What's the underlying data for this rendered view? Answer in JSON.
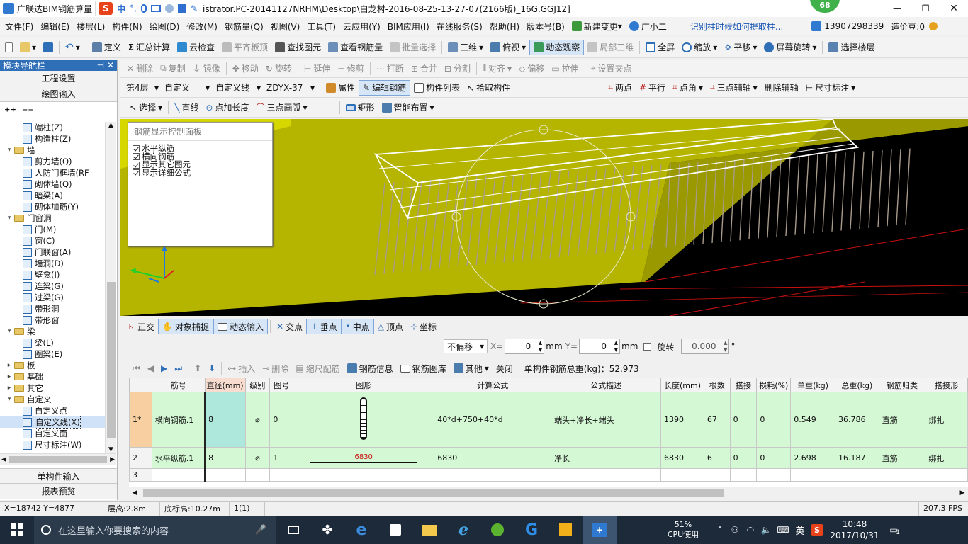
{
  "title_bar": {
    "app": "广联达BIM钢筋算量",
    "path": "istrator.PC-20141127NRHM\\Desktop\\白龙村-2016-08-25-13-27-07(2166版)_16G.GGJ12]",
    "badge": "68"
  },
  "menu": [
    "文件(F)",
    "编辑(E)",
    "楼层(L)",
    "构件(N)",
    "绘图(D)",
    "修改(M)",
    "钢筋量(Q)",
    "视图(V)",
    "工具(T)",
    "云应用(Y)",
    "BIM应用(I)",
    "在线服务(S)",
    "帮助(H)",
    "版本号(B)",
    "新建变更",
    "广小二"
  ],
  "menu_right": {
    "hint": "识别柱时候如何提取柱...",
    "phone": "13907298339",
    "points": "造价豆:0"
  },
  "toolbar1": [
    "定义",
    "汇总计算",
    "云检查",
    "平齐板顶",
    "查找图元",
    "查看钢筋量",
    "批量选择",
    "三维",
    "俯视",
    "动态观察",
    "局部三维",
    "全屏",
    "缩放",
    "平移",
    "屏幕旋转",
    "选择楼层"
  ],
  "toolbar2": [
    "删除",
    "复制",
    "镜像",
    "移动",
    "旋转",
    "延伸",
    "修剪",
    "打断",
    "合并",
    "分割",
    "对齐",
    "偏移",
    "拉伸",
    "设置夹点"
  ],
  "toolbar3": {
    "floor": "第4层",
    "type": "自定义",
    "subtype": "自定义线",
    "name": "ZDYX-37",
    "buttons": [
      "属性",
      "编辑钢筋",
      "构件列表",
      "拾取构件"
    ],
    "right": [
      "两点",
      "平行",
      "点角",
      "三点辅轴",
      "删除辅轴",
      "尺寸标注"
    ]
  },
  "toolbar4": [
    "选择",
    "直线",
    "点加长度",
    "三点画弧",
    "矩形",
    "智能布置"
  ],
  "sidebar": {
    "header": "模块导航栏",
    "btn_project": "工程设置",
    "btn_draw": "绘图输入",
    "tree": [
      {
        "indent": 2,
        "label": "端柱(Z)"
      },
      {
        "indent": 2,
        "label": "构造柱(Z)"
      },
      {
        "indent": 0,
        "label": "墙",
        "folder": true,
        "open": true
      },
      {
        "indent": 2,
        "label": "剪力墙(Q)"
      },
      {
        "indent": 2,
        "label": "人防门框墙(RF"
      },
      {
        "indent": 2,
        "label": "砌体墙(Q)"
      },
      {
        "indent": 2,
        "label": "暗梁(A)"
      },
      {
        "indent": 2,
        "label": "砌体加筋(Y)"
      },
      {
        "indent": 0,
        "label": "门窗洞",
        "folder": true,
        "open": true
      },
      {
        "indent": 2,
        "label": "门(M)"
      },
      {
        "indent": 2,
        "label": "窗(C)"
      },
      {
        "indent": 2,
        "label": "门联窗(A)"
      },
      {
        "indent": 2,
        "label": "墙洞(D)"
      },
      {
        "indent": 2,
        "label": "壁龛(I)"
      },
      {
        "indent": 2,
        "label": "连梁(G)"
      },
      {
        "indent": 2,
        "label": "过梁(G)"
      },
      {
        "indent": 2,
        "label": "带形洞"
      },
      {
        "indent": 2,
        "label": "带形窗"
      },
      {
        "indent": 0,
        "label": "梁",
        "folder": true,
        "open": true
      },
      {
        "indent": 2,
        "label": "梁(L)"
      },
      {
        "indent": 2,
        "label": "圈梁(E)"
      },
      {
        "indent": 0,
        "label": "板",
        "folder": true,
        "open": false
      },
      {
        "indent": 0,
        "label": "基础",
        "folder": true,
        "open": false
      },
      {
        "indent": 0,
        "label": "其它",
        "folder": true,
        "open": false
      },
      {
        "indent": 0,
        "label": "自定义",
        "folder": true,
        "open": true
      },
      {
        "indent": 2,
        "label": "自定义点"
      },
      {
        "indent": 2,
        "label": "自定义线(X)",
        "selected": true
      },
      {
        "indent": 2,
        "label": "自定义面"
      },
      {
        "indent": 2,
        "label": "尺寸标注(W)"
      }
    ],
    "btn_single": "单构件输入",
    "btn_report": "报表预览"
  },
  "panel": {
    "title": "钢筋显示控制面板",
    "items": [
      "水平纵筋",
      "横向钢筋",
      "显示其它图元",
      "显示详细公式"
    ]
  },
  "snapbar": [
    "正交",
    "对象捕捉",
    "动态输入",
    "交点",
    "垂点",
    "中点",
    "顶点",
    "坐标"
  ],
  "offsetbar": {
    "mode": "不偏移",
    "x_label": "X=",
    "x": "0",
    "y_label": "Y=",
    "y": "0",
    "unit": "mm",
    "rotate_label": "旋转",
    "rotate": "0.000",
    "deg": "°"
  },
  "gridbar": {
    "buttons": [
      "插入",
      "删除",
      "缩尺配筋",
      "钢筋信息",
      "钢筋图库",
      "其他",
      "关闭"
    ],
    "total": "单构件钢筋总重(kg)：52.973"
  },
  "table": {
    "headers": [
      "筋号",
      "直径(mm)",
      "级别",
      "图号",
      "图形",
      "计算公式",
      "公式描述",
      "长度(mm)",
      "根数",
      "搭接",
      "损耗(%)",
      "单重(kg)",
      "总重(kg)",
      "钢筋归类",
      "搭接形"
    ],
    "rows": [
      {
        "no": "1*",
        "cells": [
          "横向钢筋.1",
          "8",
          "⌀",
          "0",
          "",
          "40*d+750+40*d",
          "端头+净长+端头",
          "1390",
          "67",
          "0",
          "0",
          "0.549",
          "36.786",
          "直筋",
          "绑扎"
        ]
      },
      {
        "no": "2",
        "cells": [
          "水平纵筋.1",
          "8",
          "⌀",
          "1",
          "6830",
          "6830",
          "净长",
          "6830",
          "6",
          "0",
          "0",
          "2.698",
          "16.187",
          "直筋",
          "绑扎"
        ]
      },
      {
        "no": "3",
        "cells": [
          "",
          "",
          "",
          "",
          "",
          "",
          "",
          "",
          "",
          "",
          "",
          "",
          "",
          "",
          ""
        ]
      }
    ]
  },
  "statusbar": {
    "coords": "X=18742 Y=4877",
    "floor_height": "层高:2.8m",
    "base_height": "底标高:10.27m",
    "count": "1(1)",
    "fps": "207.3 FPS"
  },
  "taskbar": {
    "search": "在这里输入你要搜索的内容",
    "cpu_pct": "51%",
    "cpu_label": "CPU使用",
    "ime": "英",
    "time": "10:48",
    "date": "2017/10/31",
    "notif": "1"
  }
}
